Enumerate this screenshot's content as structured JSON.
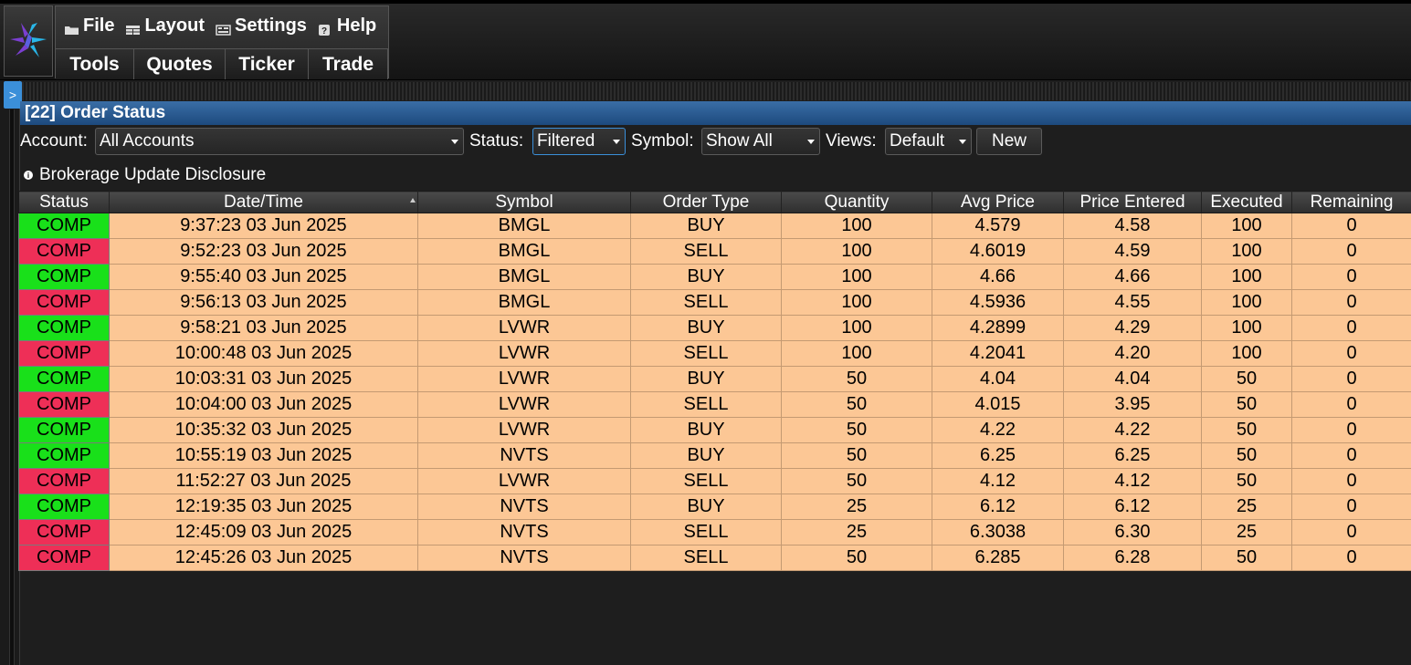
{
  "menu": {
    "items": [
      {
        "label": "File",
        "icon": "folder-icon"
      },
      {
        "label": "Layout",
        "icon": "layout-icon"
      },
      {
        "label": "Settings",
        "icon": "settings-icon"
      },
      {
        "label": "Help",
        "icon": "help-icon"
      }
    ],
    "tabs": [
      "Tools",
      "Quotes",
      "Ticker",
      "Trade"
    ]
  },
  "side_toggle": ">",
  "panel": {
    "title": "[22] Order Status"
  },
  "filters": {
    "account_label": "Account:",
    "account_value": "All Accounts",
    "status_label": "Status:",
    "status_value": "Filtered",
    "symbol_label": "Symbol:",
    "symbol_value": "Show All",
    "views_label": "Views:",
    "views_value": "Default",
    "new_label": "New"
  },
  "disclosure": {
    "icon_glyph": "i",
    "label": "Brokerage Update Disclosure"
  },
  "colors": {
    "buy_status": "#19e01a",
    "sell_status": "#ee2f57",
    "row_bg": "#fcc795",
    "title_bar": "#2a5b91"
  },
  "table": {
    "columns": [
      "Status",
      "Date/Time",
      "Symbol",
      "Order Type",
      "Quantity",
      "Avg Price",
      "Price Entered",
      "Executed",
      "Remaining"
    ],
    "rows": [
      [
        "COMP",
        "9:37:23 03 Jun 2025",
        "BMGL",
        "BUY",
        "100",
        "4.579",
        "4.58",
        "100",
        "0"
      ],
      [
        "COMP",
        "9:52:23 03 Jun 2025",
        "BMGL",
        "SELL",
        "100",
        "4.6019",
        "4.59",
        "100",
        "0"
      ],
      [
        "COMP",
        "9:55:40 03 Jun 2025",
        "BMGL",
        "BUY",
        "100",
        "4.66",
        "4.66",
        "100",
        "0"
      ],
      [
        "COMP",
        "9:56:13 03 Jun 2025",
        "BMGL",
        "SELL",
        "100",
        "4.5936",
        "4.55",
        "100",
        "0"
      ],
      [
        "COMP",
        "9:58:21 03 Jun 2025",
        "LVWR",
        "BUY",
        "100",
        "4.2899",
        "4.29",
        "100",
        "0"
      ],
      [
        "COMP",
        "10:00:48 03 Jun 2025",
        "LVWR",
        "SELL",
        "100",
        "4.2041",
        "4.20",
        "100",
        "0"
      ],
      [
        "COMP",
        "10:03:31 03 Jun 2025",
        "LVWR",
        "BUY",
        "50",
        "4.04",
        "4.04",
        "50",
        "0"
      ],
      [
        "COMP",
        "10:04:00 03 Jun 2025",
        "LVWR",
        "SELL",
        "50",
        "4.015",
        "3.95",
        "50",
        "0"
      ],
      [
        "COMP",
        "10:35:32 03 Jun 2025",
        "LVWR",
        "BUY",
        "50",
        "4.22",
        "4.22",
        "50",
        "0"
      ],
      [
        "COMP",
        "10:55:19 03 Jun 2025",
        "NVTS",
        "BUY",
        "50",
        "6.25",
        "6.25",
        "50",
        "0"
      ],
      [
        "COMP",
        "11:52:27 03 Jun 2025",
        "LVWR",
        "SELL",
        "50",
        "4.12",
        "4.12",
        "50",
        "0"
      ],
      [
        "COMP",
        "12:19:35 03 Jun 2025",
        "NVTS",
        "BUY",
        "25",
        "6.12",
        "6.12",
        "25",
        "0"
      ],
      [
        "COMP",
        "12:45:09 03 Jun 2025",
        "NVTS",
        "SELL",
        "25",
        "6.3038",
        "6.30",
        "25",
        "0"
      ],
      [
        "COMP",
        "12:45:26 03 Jun 2025",
        "NVTS",
        "SELL",
        "50",
        "6.285",
        "6.28",
        "50",
        "0"
      ]
    ]
  }
}
